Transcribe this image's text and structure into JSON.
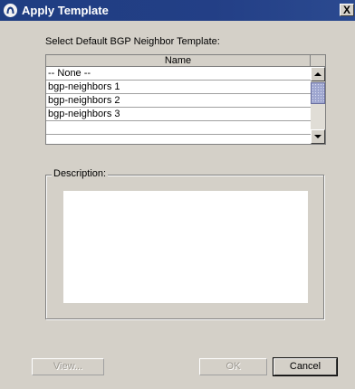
{
  "window": {
    "title": "Apply Template",
    "close_label": "X"
  },
  "main": {
    "prompt": "Select Default BGP Neighbor Template:",
    "table": {
      "columns": [
        "Name"
      ],
      "rows": [
        "-- None --",
        "bgp-neighbors 1",
        "bgp-neighbors 2",
        "bgp-neighbors 3",
        ""
      ]
    },
    "description": {
      "label": "Description:",
      "value": ""
    }
  },
  "buttons": {
    "view_label": "View...",
    "ok_label": "OK",
    "cancel_label": "Cancel"
  },
  "colors": {
    "titlebar": "#233f86",
    "dialog_bg": "#d4d0c8",
    "scroll_thumb": "#9ea6cf"
  },
  "icons": {
    "title": "app-logo-icon",
    "scroll_up": "arrow-up-icon",
    "scroll_down": "arrow-down-icon"
  }
}
